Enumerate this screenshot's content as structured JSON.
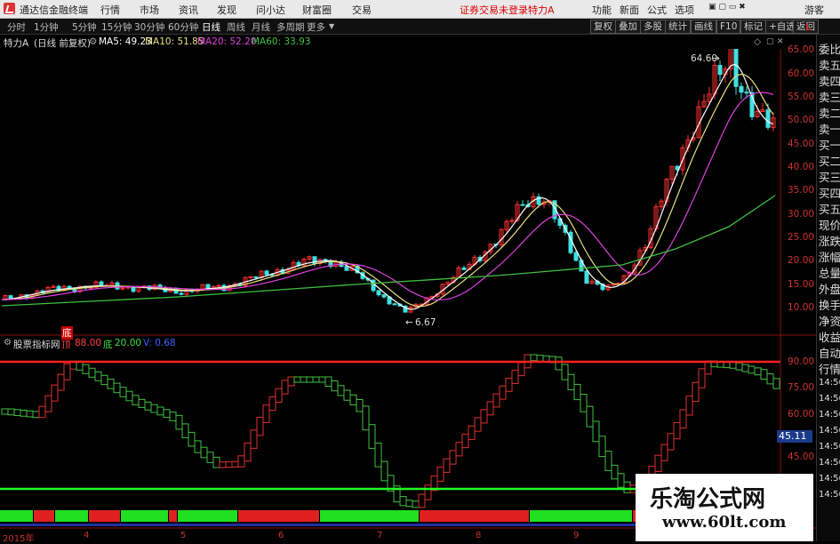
{
  "titlebar": {
    "app_name": "通达信金融终端",
    "menu": [
      "行情",
      "市场",
      "资讯",
      "发现",
      "问小达",
      "财富圈",
      "交易"
    ],
    "status": "证券交易未登录",
    "stock": "特力A",
    "right_menu": [
      "功能",
      "新面",
      "公式",
      "选项"
    ],
    "user": "游客"
  },
  "tabs": {
    "items": [
      "分时",
      "1分钟",
      "5分钟",
      "15分钟",
      "30分钟",
      "60分钟",
      "日线",
      "周线",
      "月线",
      "多周期",
      "更多"
    ],
    "active": "日线",
    "right_buttons": [
      "复权",
      "叠加",
      "多股",
      "统计",
      "画线",
      "F10",
      "标记",
      "+自选",
      "返回"
    ]
  },
  "infobar": {
    "title": "特力A",
    "mode": "(日线 前复权)",
    "ma5": "MA5: 49.23",
    "ma10": "MA10: 51.85",
    "ma20": "MA20: 52.20",
    "ma60": "MA60: 33.93",
    "colors": {
      "ma5": "#ffffff",
      "ma10": "#e8e080",
      "ma20": "#e040e0",
      "ma60": "#40c040"
    }
  },
  "annotations": {
    "high": "64.60",
    "low": "6.67"
  },
  "price_axis": {
    "ticks": [
      "65.00",
      "60.00",
      "55.00",
      "50.00",
      "45.00",
      "40.00",
      "35.00",
      "30.00",
      "25.00",
      "20.00",
      "15.00",
      "10.00"
    ],
    "corner": "L"
  },
  "indicator": {
    "name": "股票指标网",
    "tag": "底",
    "top_label": "顶",
    "top_value": "88.00",
    "low_label": "底",
    "low_value": "20.00",
    "v_label": "V: 0.68",
    "axis_ticks": [
      "90.00",
      "75.00",
      "60.00",
      "45.00"
    ],
    "current_value": "45.11"
  },
  "sidebar": {
    "items": [
      "委比",
      "卖五",
      "卖四",
      "卖三",
      "卖二",
      "卖一",
      "买一",
      "买二",
      "买三",
      "买四",
      "买五",
      "现价",
      "涨跌",
      "涨幅",
      "总量",
      "外盘",
      "换手",
      "净资",
      "收益",
      "自动",
      "行情"
    ],
    "times": [
      "14:56",
      "14:56",
      "14:56",
      "14:56",
      "14:56",
      "14:56",
      "14:56",
      "14:56"
    ]
  },
  "dates": [
    "2015年",
    "4",
    "5",
    "6",
    "7",
    "8",
    "9"
  ],
  "watermark": {
    "name": "乐淘公式网",
    "url": "www.60lt.com"
  },
  "colors": {
    "up": "#ff3030",
    "down": "#40e0e0",
    "ind_up": "#e03030",
    "ind_down": "#40c040",
    "top_line": "#ff2020",
    "bottom_line": "#20ff20"
  }
}
